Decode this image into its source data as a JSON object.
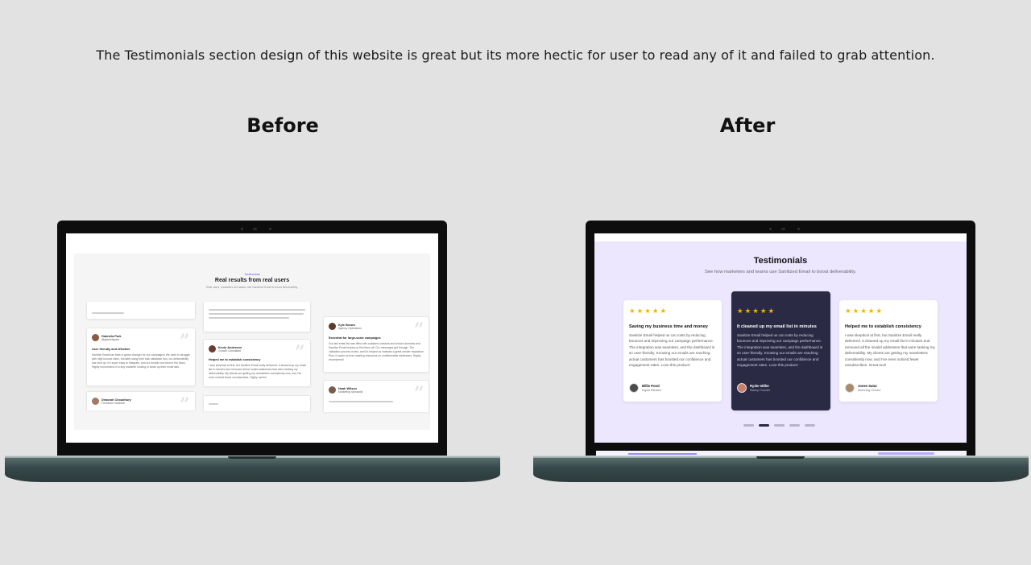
{
  "caption": "The Testimonials section design of this website is great but its more hectic for user to read any of it and failed to grab attention.",
  "labels": {
    "before": "Before",
    "after": "After"
  },
  "before": {
    "eyebrow": "Testimonials",
    "title": "Real results from real users",
    "subtitle": "Real users, marketers and teams use Sanitized Email to boost deliverability.",
    "cards": [
      {
        "name": "Gabriela Park",
        "role": "@gabrielapark",
        "title": "User friendly and effective",
        "body": "Sanitize Email has been a game changer for our campaigns! We used to struggle with high bounce rates, but after using their bulk validation tool, our deliverability has shot up. It's super easy to integrate, and our emails now land in the inbox. Highly recommend it to any marketer looking to clean up their email lists."
      },
      {
        "name": "Deborah Choudhury",
        "role": "Freelance Marketer"
      },
      {
        "name": "Kevin Anderson",
        "role": "Growth Consultant",
        "title": "Helped me to establish consistency",
        "body": "I was skeptical at first, but Sanitize Email really delivered. It cleaned up my email list in minutes and removed all the invalid addresses that were tanking my deliverability. My clients are getting my newsletters consistently now, and I've even noticed fewer unsubscribes. Highly useful!"
      },
      {
        "name": "Kyle Brown",
        "role": "Agency Operations",
        "title": "Essential for large-scale campaigns",
        "body": "Our last email list was filled with outdated contacts and broken domains and Sanitize Email helped us find them all. Our messages get through. The validation process is fast, and it's helped us maintain a great sender reputation. Plus, it saves us from wasting resources on undeliverable addresses. Highly recommend!"
      },
      {
        "name": "Noah Wilson",
        "role": "Marketing Specialist"
      }
    ]
  },
  "after": {
    "title": "Testimonials",
    "subtitle": "See how marketers and teams use Sanitized Email to boost deliverability.",
    "stars": "★★★★★",
    "cards": [
      {
        "title": "Saving my business time and money",
        "body": "Sanitize Email helped us cut costs by reducing bounces and improving our campaign performance. The integration was seamless, and the dashboard is so user-friendly. Knowing our emails are reaching actual customers has boosted our confidence and engagement rates. Love this product!",
        "name": "Billie Pond",
        "role": "Digital Marketer"
      },
      {
        "title": "It cleaned up my email list in minutes",
        "body": "Sanitize Email helped us cut costs by reducing bounces and improving our campaign performance. The integration was seamless, and the dashboard is so user-friendly. Knowing our emails are reaching actual customers has boosted our confidence and engagement rates. Love this product!",
        "name": "Ryder Miller",
        "role": "Startup Founder"
      },
      {
        "title": "Helped me to establish consistency",
        "body": "I was skeptical at first, but Sanitize Email really delivered. It cleaned up my email list in minutes and removed all the invalid addresses that were tanking my deliverability. My clients are getting my newsletters consistently now, and I've even noticed fewer unsubscribes. Great tool!",
        "name": "Jones Satur",
        "role": "Marketing Director"
      }
    ],
    "carousel": {
      "total": 5,
      "active": 2
    }
  },
  "colors": {
    "background": "#e2e2e2",
    "after_section": "#ece6ff",
    "dark_card": "#2b2a44",
    "star": "#f6b100"
  }
}
